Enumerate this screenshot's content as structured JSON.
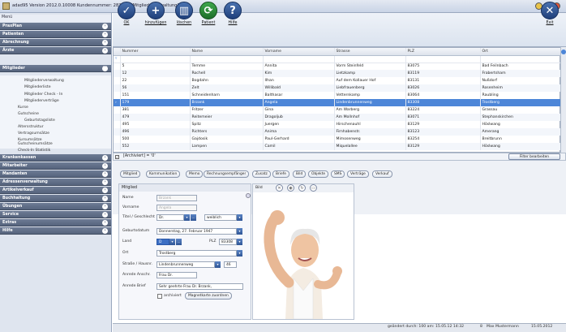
{
  "window": {
    "title": "adad95 Version 2012.0.10008 Kundennummer: 28315 - [Mitgliederverwaltung]"
  },
  "sidebar": {
    "menu": "Menü",
    "headers": [
      "PraxPlan",
      "Patienten",
      "Abrechnung",
      "Ärzte",
      "Mitglieder",
      "Krankenkassen",
      "Mitarbeiter",
      "Mandanten",
      "Adressenverwaltung",
      "Artikelverkauf",
      "Buchhaltung",
      "Übungen",
      "Service",
      "Extras",
      "Hilfe"
    ],
    "items": [
      "Mitgliederverwaltung",
      "Mitgliederliste",
      "Mitglieder Check - In",
      "Mitgliederverträge",
      "Kurse",
      "Gutscheine",
      "Geburtstagsliste",
      "Altersstruktur",
      "Vertragsumsätze",
      "Kursumsätze",
      "Gutscheinumsätze",
      "Check-In Statistik"
    ]
  },
  "toolbar": {
    "ok": "OK",
    "add": "hinzufügen",
    "delete": "löschen",
    "patient": "Patient",
    "help": "Hilfe",
    "exit": "Exit"
  },
  "grid": {
    "columns": [
      "Nummer",
      "Name",
      "Vorname",
      "Strasse",
      "PLZ",
      "Ort"
    ],
    "rows": [
      [
        "5",
        "Temme",
        "Annita",
        "Vorm Steinfeld",
        "83075",
        "Bad Feilnbach"
      ],
      [
        "12",
        "Rochell",
        "Kim",
        "Lietzkamp",
        "83119",
        "Frabertsham"
      ],
      [
        "22",
        "Bogdahn",
        "Ilhan",
        "Auf dem Kollauer Hof",
        "83131",
        "Nußdorf"
      ],
      [
        "56",
        "Zelt",
        "Willibald",
        "Liebfrauenberg",
        "83026",
        "Rosenheim"
      ],
      [
        "151",
        "Schneidenharn",
        "Balthasar",
        "Vetternkamp",
        "83064",
        "Raubling"
      ],
      [
        "179",
        "Brzank",
        "Angela",
        "Lindenbrunnenweg",
        "83308",
        "Trostberg"
      ],
      [
        "381",
        "Fritzer",
        "Gina",
        "Am Warberg",
        "83224",
        "Grassau"
      ],
      [
        "479",
        "Reitemeier",
        "Dragoljub",
        "Am Mollnhof",
        "83071",
        "Stephanskirchen"
      ],
      [
        "495",
        "Spitz",
        "Juergen",
        "Hirschenauhl",
        "83129",
        "Höslwang"
      ],
      [
        "496",
        "Richters",
        "Anima",
        "Firnhabenstr.",
        "83123",
        "Amerang"
      ],
      [
        "500",
        "Gajdosik",
        "Paul-Gerhard",
        "Mimosenweg",
        "83254",
        "Breitbrunn"
      ],
      [
        "552",
        "Lampen",
        "Camil",
        "Miquelallee",
        "83129",
        "Höslwang"
      ]
    ],
    "selected_index": 5
  },
  "filter": {
    "text": "[Archiviert] = '0'",
    "button": "Filter bearbeiten"
  },
  "tabs": [
    "Mitglied",
    "Kommunikation",
    "Memo",
    "Rechnungsempfänger",
    "Zusatz",
    "Briefe",
    "Bild",
    "Objekte",
    "SMS",
    "Verträge",
    "Verkauf"
  ],
  "form": {
    "header": "Mitglied",
    "name_label": "Name",
    "name_value": "Brzank",
    "vorname_label": "Vorname",
    "vorname_value": "Angela",
    "titel_label": "Titel / Geschlecht",
    "titel_value": "Dr.",
    "geschlecht_value": "weiblich",
    "geburt_label": "Geburtsdatum",
    "geburt_value": "Donnerstag, 27. Februar 1947",
    "land_label": "Land",
    "land_value": "D",
    "plz_label": "PLZ",
    "plz_value": "83308",
    "ort_label": "Ort",
    "ort_value": "Trostberg",
    "strasse_label": "Straße / Hausnr.",
    "strasse_value": "Lindenbrunnenweg",
    "hausnr_value": "46",
    "anrede_label": "Anrede Anschr.",
    "anrede_value": "Frau Dr.",
    "brief_label": "Anrede Brief",
    "brief_value": "Sehr geehrte Frau Dr. Brzank,",
    "archiviert_label": "archiviert",
    "magnet_button": "Magnetkarte zuordnen"
  },
  "picture": {
    "header": "Bild"
  },
  "status": {
    "changed": "geändert durch: 100 am: 15.05.12 14:32",
    "count": "8",
    "user": "Max Mustermann",
    "date": "15.05.2012"
  }
}
